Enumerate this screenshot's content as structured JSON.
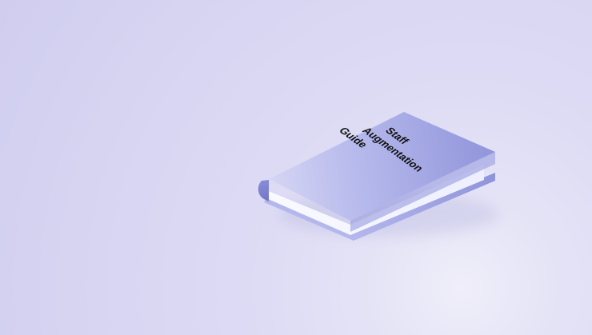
{
  "book": {
    "title_lines": [
      "Staff",
      "Augmentation",
      "Guide"
    ]
  },
  "colors": {
    "background": "#d8d7f2",
    "cover_light": "#c8c8f0",
    "cover_dark": "#8f93d9",
    "spine": "#7f83cf",
    "pages": "#f6f7ff",
    "shadow": "#a8a7d8"
  }
}
